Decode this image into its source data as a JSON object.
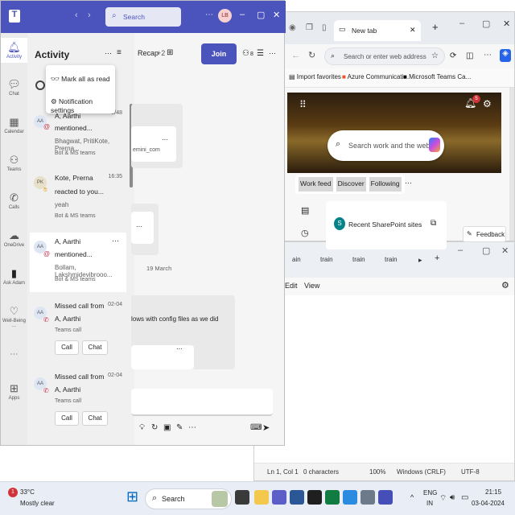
{
  "notepad": {
    "tabs": [
      "ain",
      "train",
      "train",
      "train"
    ],
    "menus": [
      "Edit",
      "View"
    ],
    "status": {
      "position": "Ln 1, Col 1",
      "characters": "0 characters",
      "zoom": "100%",
      "line_endings": "Windows (CRLF)",
      "encoding": "UTF-8"
    }
  },
  "edge": {
    "tab_title": "New tab",
    "address_placeholder": "Search or enter web address",
    "favorites": [
      "Import favorites",
      "Azure Communicati...",
      "Microsoft Teams Ca..."
    ],
    "search_placeholder": "Search work and the web",
    "feed_tabs": [
      "Work feed",
      "Discover",
      "Following"
    ],
    "card_title": "Recent SharePoint sites",
    "feedback_label": "Feedback",
    "badge": "5"
  },
  "teams": {
    "search_placeholder": "Search",
    "avatar_initials": "LB",
    "rail": [
      "Activity",
      "Chat",
      "Calendar",
      "Teams",
      "Calls",
      "OneDrive",
      "Ask Adam",
      "Well-Being ...",
      "Apps"
    ],
    "activity_title": "Activity",
    "menu": [
      "Mark all as read",
      "Notification settings"
    ],
    "header": {
      "recap_label": "Recap",
      "recap_count": "+2",
      "join_label": "Join",
      "participants": "8"
    },
    "activities": [
      {
        "initials": "AA",
        "title": "A, Aarthi",
        "subtitle": "mentioned...",
        "detail": "Bhagwat, PritiKote, Prerna...",
        "context": "Bot & MS teams",
        "time": "2/48"
      },
      {
        "initials": "PK",
        "title": "Kote, Prerna",
        "subtitle": "reacted to you...",
        "detail": "yeah",
        "context": "Bot & MS teams",
        "time": "16:35"
      },
      {
        "initials": "AA",
        "title": "A, Aarthi",
        "subtitle": "mentioned...",
        "detail": "Bollam, Lakshmidevibrooo...",
        "context": "Bot & MS teams",
        "time": ""
      },
      {
        "initials": "AA",
        "title": "Missed call from",
        "subtitle": "A, Aarthi",
        "detail": "Teams call",
        "time": "02-04",
        "call_label": "Call",
        "chat_label": "Chat"
      },
      {
        "initials": "AA",
        "title": "Missed call from",
        "subtitle": "A, Aarthi",
        "detail": "Teams call",
        "time": "02-04",
        "call_label": "Call",
        "chat_label": "Chat"
      }
    ],
    "chat": {
      "mail_fragment": "emini_com",
      "date_label": "19 March",
      "message_fragment": "lows with config files as we did"
    }
  },
  "taskbar": {
    "weather_temp": "33°C",
    "weather_desc": "Mostly clear",
    "search_label": "Search",
    "lang": "ENG",
    "region": "IN",
    "time": "21:15",
    "date": "03-04-2024",
    "weather_badge": "1"
  }
}
